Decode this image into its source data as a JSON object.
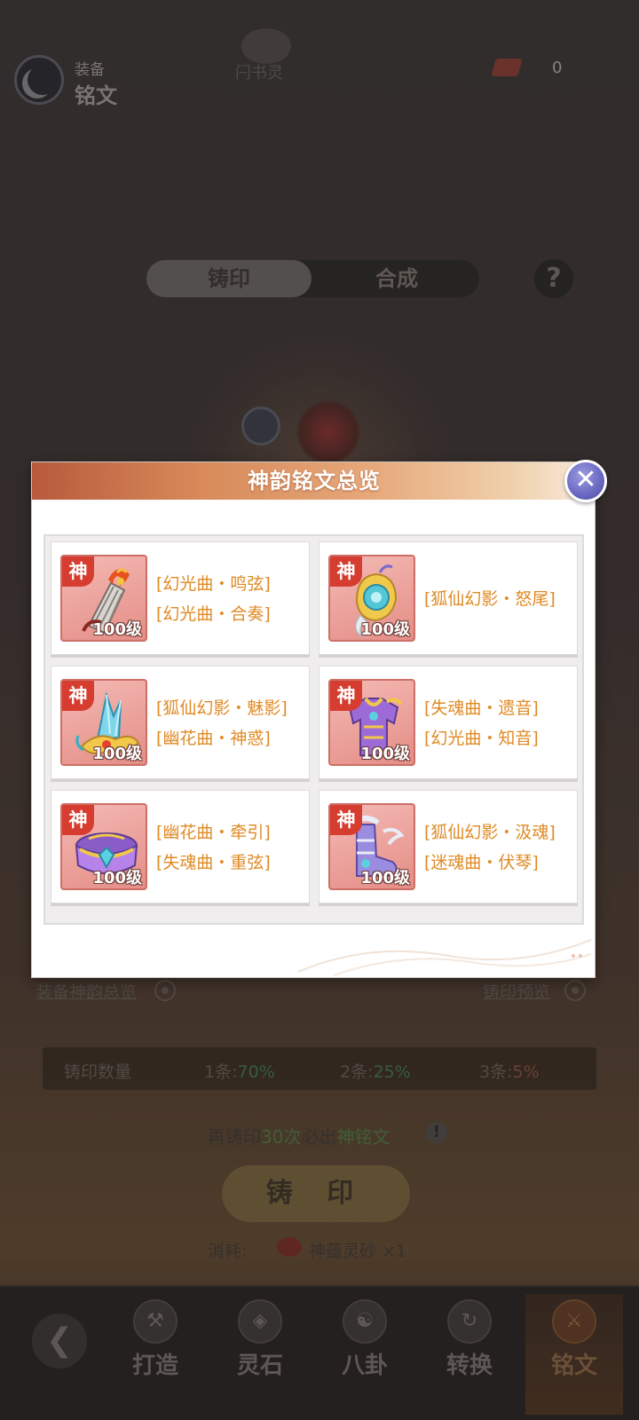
{
  "background": {
    "header": {
      "subtitle": "装备",
      "title": "铭文",
      "deco_label": "闩书灵",
      "currency_value": "0"
    },
    "tabs": [
      {
        "label": "铸印",
        "active": true
      },
      {
        "label": "合成",
        "active": false
      }
    ],
    "help_label": "?",
    "links": {
      "left": "装备神韵总览",
      "right": "铸印预览"
    },
    "probabilities": {
      "label": "铸印数量",
      "items": [
        {
          "prefix": "1条:",
          "value": "70%"
        },
        {
          "prefix": "2条:",
          "value": "25%"
        },
        {
          "prefix": "3条:",
          "value": "5%"
        }
      ]
    },
    "guarantee": {
      "pre": "再铸印",
      "count": "30次",
      "mid": "必出",
      "target": "神铭文"
    },
    "forge_button": "铸 印",
    "cost": {
      "label": "消耗:",
      "item": "神蕴灵砂 ×1"
    },
    "nav": [
      {
        "label": "打造",
        "icon": "hammer-anvil-icon"
      },
      {
        "label": "灵石",
        "icon": "spirit-stone-icon"
      },
      {
        "label": "八卦",
        "icon": "bagua-icon"
      },
      {
        "label": "转换",
        "icon": "transform-icon"
      },
      {
        "label": "铭文",
        "icon": "rune-sword-icon",
        "active": true
      }
    ]
  },
  "modal": {
    "title": "神韵铭文总览",
    "close_icon": "close-icon",
    "cards": [
      {
        "tag": "神",
        "level": "100级",
        "item_icon": "harp-bracer-icon",
        "runes": [
          "[幻光曲・鸣弦]",
          "[幻光曲・合奏]"
        ]
      },
      {
        "tag": "神",
        "level": "100级",
        "item_icon": "fox-amulet-icon",
        "runes": [
          "[狐仙幻影・怒尾]"
        ]
      },
      {
        "tag": "神",
        "level": "100级",
        "item_icon": "crystal-hairpin-icon",
        "runes": [
          "[狐仙幻影・魅影]",
          "[幽花曲・神惑]"
        ]
      },
      {
        "tag": "神",
        "level": "100级",
        "item_icon": "purple-armor-icon",
        "runes": [
          "[失魂曲・遗音]",
          "[幻光曲・知音]"
        ]
      },
      {
        "tag": "神",
        "level": "100级",
        "item_icon": "purple-belt-icon",
        "runes": [
          "[幽花曲・牵引]",
          "[失魂曲・重弦]"
        ]
      },
      {
        "tag": "神",
        "level": "100级",
        "item_icon": "purple-boots-icon",
        "runes": [
          "[狐仙幻影・汲魂]",
          "[迷魂曲・伏琴]"
        ]
      }
    ]
  },
  "colors": {
    "rune_text": "#e08a24",
    "shen_tag": "#d63d30",
    "header_gradient_start": "#b85a3c",
    "close_button": "#6d6cc4"
  }
}
